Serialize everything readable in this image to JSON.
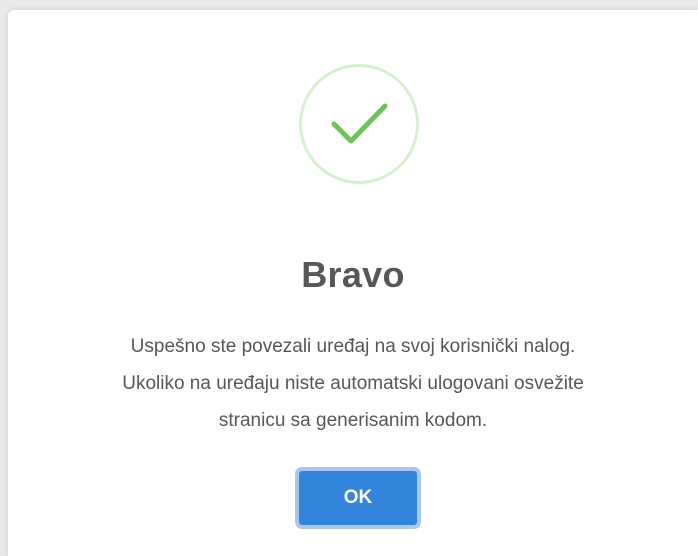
{
  "dialog": {
    "icon": "success-checkmark-icon",
    "title": "Bravo",
    "message_lines": [
      "Uspešno ste povezali uređaj na svoj korisnički nalog.",
      "Ukoliko na uređaju niste automatski ulogovani osvežite",
      "stranicu sa generisanim kodom."
    ],
    "ok_label": "OK"
  },
  "colors": {
    "check": "#6cc456",
    "icon_ring": "#d8efcf",
    "button": "#3385dc",
    "button_focus_ring": "#a9c8ec",
    "text": "#575757"
  }
}
